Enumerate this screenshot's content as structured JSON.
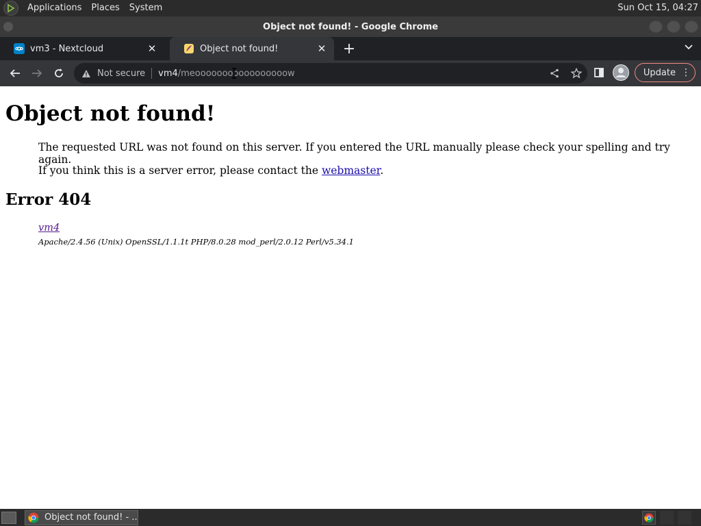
{
  "top_panel": {
    "menus": [
      "Applications",
      "Places",
      "System"
    ],
    "clock": "Sun Oct 15, 04:27"
  },
  "window": {
    "title": "Object not found! - Google Chrome"
  },
  "tabs": [
    {
      "label": "vm3 - Nextcloud",
      "icon": "nextcloud-icon",
      "active": false
    },
    {
      "label": "Object not found!",
      "icon": "apache-feather-icon",
      "active": true
    }
  ],
  "toolbar": {
    "security_label": "Not secure",
    "url_host": "vm4",
    "url_path": "/meooooooooooooooooow",
    "update_label": "Update"
  },
  "page": {
    "heading": "Object not found!",
    "para1": "The requested URL was not found on this server. If you entered the URL manually please check your spelling and try again.",
    "para2_prefix": "If you think this is a server error, please contact the ",
    "para2_link": "webmaster",
    "para2_suffix": ".",
    "error_heading": "Error 404",
    "address_link": "vm4",
    "server_signature": "Apache/2.4.56 (Unix) OpenSSL/1.1.1t PHP/8.0.28 mod_perl/2.0.12 Perl/v5.34.1"
  },
  "taskbar": {
    "window_button": "Object not found! - ..."
  },
  "colors": {
    "panel_bg": "#2b2b2b",
    "tabstrip_bg": "#202124",
    "toolbar_bg": "#35363a",
    "link": "#1a0dab",
    "visited_link": "#551a8b",
    "update_border": "#f28b82"
  }
}
